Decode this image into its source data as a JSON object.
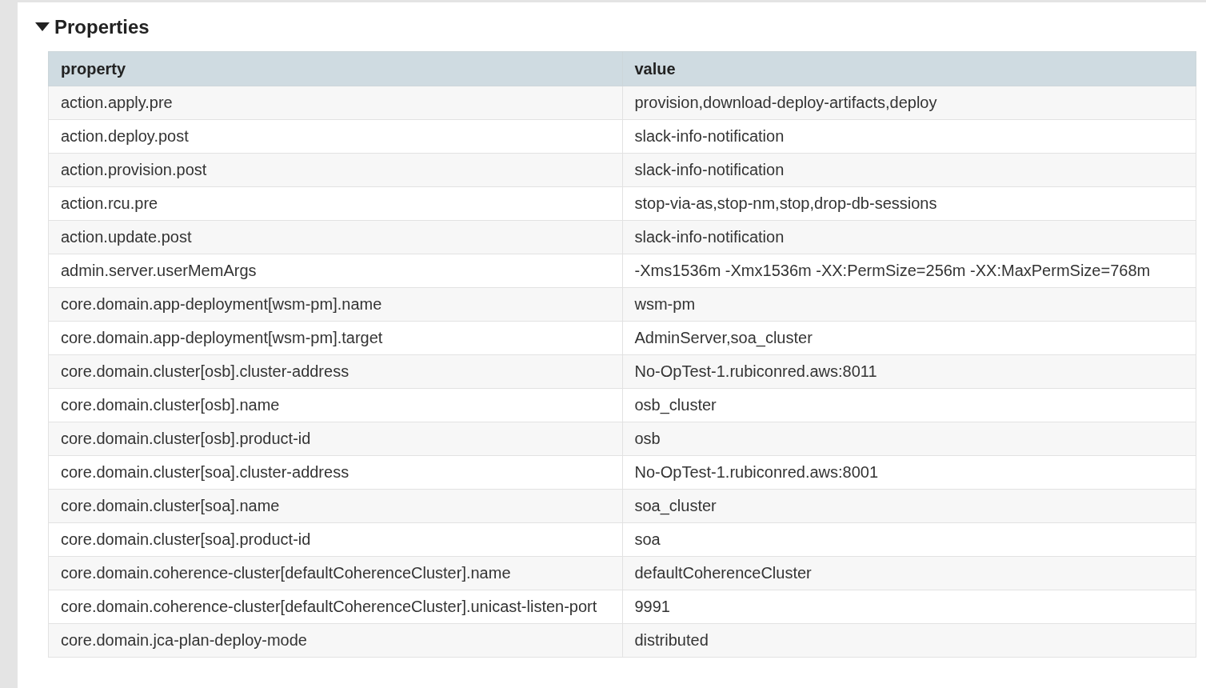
{
  "section": {
    "title": "Properties",
    "expanded": true
  },
  "table": {
    "columns": [
      "property",
      "value"
    ],
    "rows": [
      [
        "action.apply.pre",
        "provision,download-deploy-artifacts,deploy"
      ],
      [
        "action.deploy.post",
        "slack-info-notification"
      ],
      [
        "action.provision.post",
        "slack-info-notification"
      ],
      [
        "action.rcu.pre",
        "stop-via-as,stop-nm,stop,drop-db-sessions"
      ],
      [
        "action.update.post",
        "slack-info-notification"
      ],
      [
        "admin.server.userMemArgs",
        "-Xms1536m -Xmx1536m -XX:PermSize=256m -XX:MaxPermSize=768m"
      ],
      [
        "core.domain.app-deployment[wsm-pm].name",
        "wsm-pm"
      ],
      [
        "core.domain.app-deployment[wsm-pm].target",
        "AdminServer,soa_cluster"
      ],
      [
        "core.domain.cluster[osb].cluster-address",
        "No-OpTest-1.rubiconred.aws:8011"
      ],
      [
        "core.domain.cluster[osb].name",
        "osb_cluster"
      ],
      [
        "core.domain.cluster[osb].product-id",
        "osb"
      ],
      [
        "core.domain.cluster[soa].cluster-address",
        "No-OpTest-1.rubiconred.aws:8001"
      ],
      [
        "core.domain.cluster[soa].name",
        "soa_cluster"
      ],
      [
        "core.domain.cluster[soa].product-id",
        "soa"
      ],
      [
        "core.domain.coherence-cluster[defaultCoherenceCluster].name",
        "defaultCoherenceCluster"
      ],
      [
        "core.domain.coherence-cluster[defaultCoherenceCluster].unicast-listen-port",
        "9991"
      ],
      [
        "core.domain.jca-plan-deploy-mode",
        "distributed"
      ]
    ]
  }
}
